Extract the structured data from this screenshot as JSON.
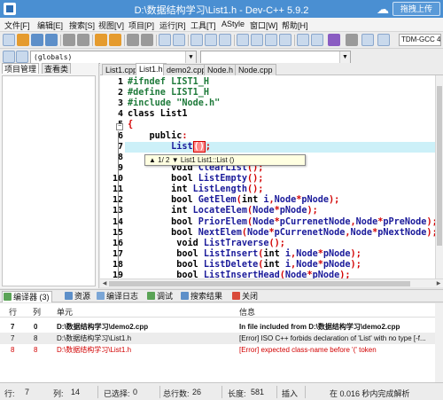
{
  "window": {
    "title": "D:\\数据结构学习\\List1.h - Dev-C++ 5.9.2",
    "upload_label": "拖拽上传"
  },
  "menu": [
    "文件[F]",
    "编辑[E]",
    "搜索[S]",
    "视图[V]",
    "项目[P]",
    "运行[R]",
    "工具[T]",
    "AStyle",
    "窗口[W]",
    "帮助[H]"
  ],
  "toolbar": {
    "compiler": "TDM-GCC 4",
    "scope_select": "(globals)"
  },
  "left_panel": {
    "tabs": [
      "项目管理",
      "查看类"
    ]
  },
  "editor_tabs": [
    "List1.cpp",
    "List1.h",
    "demo2.cpp",
    "Node.h",
    "Node.cpp"
  ],
  "editor": {
    "active_tab": "List1.h",
    "line_numbers": [
      "1",
      "2",
      "3",
      "4",
      "5",
      "6",
      "7",
      "8",
      "9",
      "10",
      "11",
      "12",
      "13",
      "14",
      "15",
      "16",
      "17",
      "18",
      "19"
    ],
    "lines": [
      "#ifndef LIST1_H",
      "#define LIST1_H",
      "#include \"Node.h\"",
      "class List1",
      "{",
      "    public:",
      "        List();",
      "",
      "        void ClearList();",
      "        bool ListEmpty();",
      "        int ListLength();",
      "        bool GetElem(int i,Node*pNode);",
      "        int LocateElem(Node*pNode);",
      "        bool PriorElem(Node*pCurrenetNode,Node*pPreNode);",
      "        bool NextElem(Node*pCurrenetNode,Node*pNextNode);",
      "         void ListTraverse();",
      "         bool ListInsert(int i,Node*pNode);",
      "         bool ListDelete(int i,Node*pNode);",
      "         bool ListInsertHead(Node*pNode);"
    ],
    "hint": "▲ 1/ 2 ▼ List1 List1::List ()"
  },
  "bottom_tabs": [
    "编译器 (3)",
    "资源",
    "编译日志",
    "调试",
    "搜索结果",
    "关闭"
  ],
  "messages": {
    "headers": [
      "行",
      "列",
      "单元",
      "信息"
    ],
    "rows": [
      {
        "line": "7",
        "col": "0",
        "unit": "D:\\数据结构学习\\demo2.cpp",
        "info": "In file included from D:\\数据结构学习\\demo2.cpp"
      },
      {
        "line": "7",
        "col": "8",
        "unit": "D:\\数据结构学习\\List1.h",
        "info": "[Error] ISO C++ forbids declaration of 'List' with no type [-f..."
      },
      {
        "line": "8",
        "col": "8",
        "unit": "D:\\数据结构学习\\List1.h",
        "info": "[Error] expected class-name before '(' token"
      }
    ]
  },
  "status": {
    "line_label": "行:",
    "line_value": "7",
    "col_label": "列:",
    "col_value": "14",
    "selected_label": "已选择:",
    "selected_value": "0",
    "total_label": "总行数:",
    "total_value": "26",
    "length_label": "长度:",
    "length_value": "581",
    "mode": "插入",
    "message": "在 0.016 秒内完成解析"
  },
  "colors": {
    "titlebar": "#4a8fd2",
    "preprocessor": "#1e7a3a",
    "error": "#d20000",
    "highlight": "#ccf0f8"
  }
}
